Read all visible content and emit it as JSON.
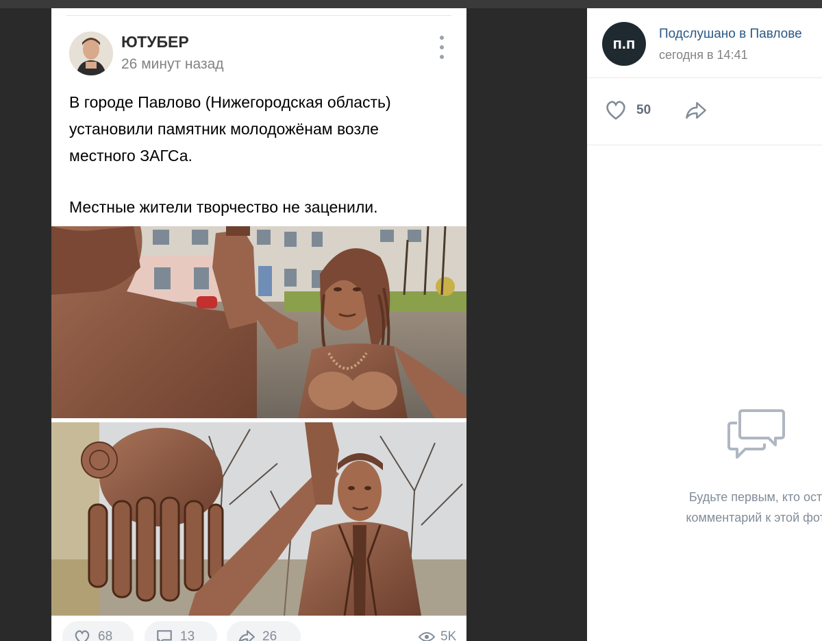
{
  "post": {
    "author": "ЮТУБЕР",
    "time": "26 минут назад",
    "text_lines": [
      "В городе Павлово (Нижегородская область)",
      "установили памятник молодожёнам возле",
      "местного ЗАГСа.",
      "Местные жители творчество не заценили."
    ],
    "actions": {
      "likes": "68",
      "comments": "13",
      "shares": "26",
      "views": "5K"
    },
    "icons": {
      "menu": "more-vertical-icon",
      "like": "heart-icon",
      "comment": "comment-icon",
      "share": "share-icon",
      "views": "eye-icon"
    }
  },
  "photo_viewer": {
    "group_name": "Подслушано в Павлове",
    "group_avatar_text": "п.п",
    "time": "сегодня в 14:41",
    "likes": "50",
    "empty_comments": [
      "Будьте первым, кто оста",
      "комментарий к этой фото"
    ],
    "icons": {
      "like": "heart-icon",
      "share": "share-icon",
      "empty": "comments-icon"
    }
  },
  "colors": {
    "link": "#2a5885",
    "muted": "#828282",
    "statue_bronze": "#8a5a44",
    "background": "#2a2a2a"
  }
}
